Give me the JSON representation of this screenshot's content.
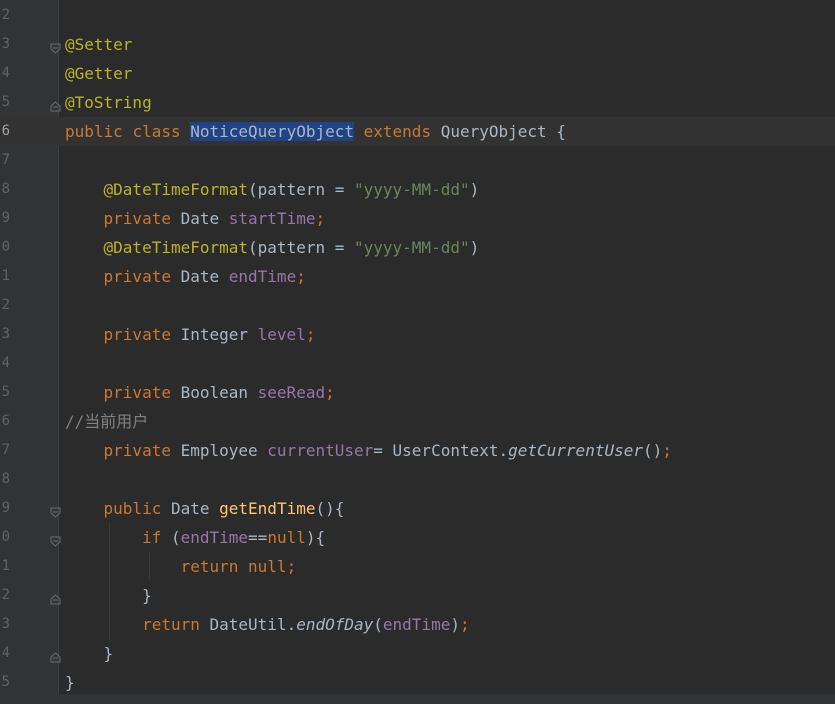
{
  "editor": {
    "colors": {
      "background": "#2b2b2b",
      "keyword": "#cc7832",
      "annotation": "#bbb529",
      "field": "#9876aa",
      "string": "#6a8759",
      "method": "#ffc66d",
      "selection": "#214283",
      "comment": "#808080"
    },
    "lines": [
      {
        "number": "2",
        "tokens": []
      },
      {
        "number": "3",
        "fold": "start",
        "tokens": [
          {
            "t": "@Setter",
            "c": "a"
          }
        ]
      },
      {
        "number": "4",
        "tokens": [
          {
            "t": "@Getter",
            "c": "a"
          }
        ]
      },
      {
        "number": "5",
        "fold": "end",
        "tokens": [
          {
            "t": "@ToString",
            "c": "a"
          }
        ]
      },
      {
        "number": "6",
        "current": true,
        "tokens": [
          {
            "t": "public ",
            "c": "k"
          },
          {
            "t": "class ",
            "c": "k"
          },
          {
            "t": "NoticeQueryObject",
            "c": "sel"
          },
          {
            "t": " "
          },
          {
            "t": "extends ",
            "c": "k"
          },
          {
            "t": "QueryObject {"
          }
        ]
      },
      {
        "number": "7",
        "tokens": []
      },
      {
        "number": "8",
        "tokens": [
          {
            "t": "    "
          },
          {
            "t": "@DateTimeFormat",
            "c": "a"
          },
          {
            "t": "(pattern = "
          },
          {
            "t": "\"yyyy-MM-dd\"",
            "c": "s"
          },
          {
            "t": ")"
          }
        ]
      },
      {
        "number": "9",
        "tokens": [
          {
            "t": "    "
          },
          {
            "t": "private ",
            "c": "k"
          },
          {
            "t": "Date "
          },
          {
            "t": "startTime",
            "c": "f"
          },
          {
            "t": ";",
            "c": "k"
          }
        ]
      },
      {
        "number": "0",
        "tokens": [
          {
            "t": "    "
          },
          {
            "t": "@DateTimeFormat",
            "c": "a"
          },
          {
            "t": "(pattern = "
          },
          {
            "t": "\"yyyy-MM-dd\"",
            "c": "s"
          },
          {
            "t": ")"
          }
        ]
      },
      {
        "number": "1",
        "tokens": [
          {
            "t": "    "
          },
          {
            "t": "private ",
            "c": "k"
          },
          {
            "t": "Date "
          },
          {
            "t": "endTime",
            "c": "f"
          },
          {
            "t": ";",
            "c": "k"
          }
        ]
      },
      {
        "number": "2",
        "tokens": []
      },
      {
        "number": "3",
        "tokens": [
          {
            "t": "    "
          },
          {
            "t": "private ",
            "c": "k"
          },
          {
            "t": "Integer "
          },
          {
            "t": "level",
            "c": "f"
          },
          {
            "t": ";",
            "c": "k"
          }
        ]
      },
      {
        "number": "4",
        "tokens": []
      },
      {
        "number": "5",
        "tokens": [
          {
            "t": "    "
          },
          {
            "t": "private ",
            "c": "k"
          },
          {
            "t": "Boolean "
          },
          {
            "t": "seeRead",
            "c": "f"
          },
          {
            "t": ";",
            "c": "k"
          }
        ]
      },
      {
        "number": "6",
        "tokens": [
          {
            "t": "//当前用户",
            "c": "c"
          }
        ]
      },
      {
        "number": "7",
        "tokens": [
          {
            "t": "    "
          },
          {
            "t": "private ",
            "c": "k"
          },
          {
            "t": "Employee "
          },
          {
            "t": "currentUser",
            "c": "f"
          },
          {
            "t": "= UserContext."
          },
          {
            "t": "getCurrentUser",
            "c": "i"
          },
          {
            "t": "()"
          },
          {
            "t": ";",
            "c": "k"
          }
        ]
      },
      {
        "number": "8",
        "tokens": []
      },
      {
        "number": "9",
        "fold": "start",
        "tokens": [
          {
            "t": "    "
          },
          {
            "t": "public ",
            "c": "k"
          },
          {
            "t": "Date "
          },
          {
            "t": "getEndTime",
            "c": "m"
          },
          {
            "t": "(){"
          }
        ]
      },
      {
        "number": "0",
        "fold": "start",
        "tokens": [
          {
            "t": "        "
          },
          {
            "t": "if ",
            "c": "k"
          },
          {
            "t": "("
          },
          {
            "t": "endTime",
            "c": "f"
          },
          {
            "t": "=="
          },
          {
            "t": "null",
            "c": "k"
          },
          {
            "t": "){"
          }
        ]
      },
      {
        "number": "1",
        "tokens": [
          {
            "t": "            "
          },
          {
            "t": "return ",
            "c": "k"
          },
          {
            "t": "null",
            "c": "k"
          },
          {
            "t": ";",
            "c": "k"
          }
        ]
      },
      {
        "number": "2",
        "fold": "end",
        "tokens": [
          {
            "t": "        }"
          }
        ]
      },
      {
        "number": "3",
        "tokens": [
          {
            "t": "        "
          },
          {
            "t": "return ",
            "c": "k"
          },
          {
            "t": "DateUtil."
          },
          {
            "t": "endOfDay",
            "c": "i"
          },
          {
            "t": "("
          },
          {
            "t": "endTime",
            "c": "f"
          },
          {
            "t": ")"
          },
          {
            "t": ";",
            "c": "k"
          }
        ]
      },
      {
        "number": "4",
        "fold": "end",
        "tokens": [
          {
            "t": "    }"
          }
        ]
      },
      {
        "number": "5",
        "tokens": [
          {
            "t": "}"
          }
        ]
      }
    ]
  }
}
